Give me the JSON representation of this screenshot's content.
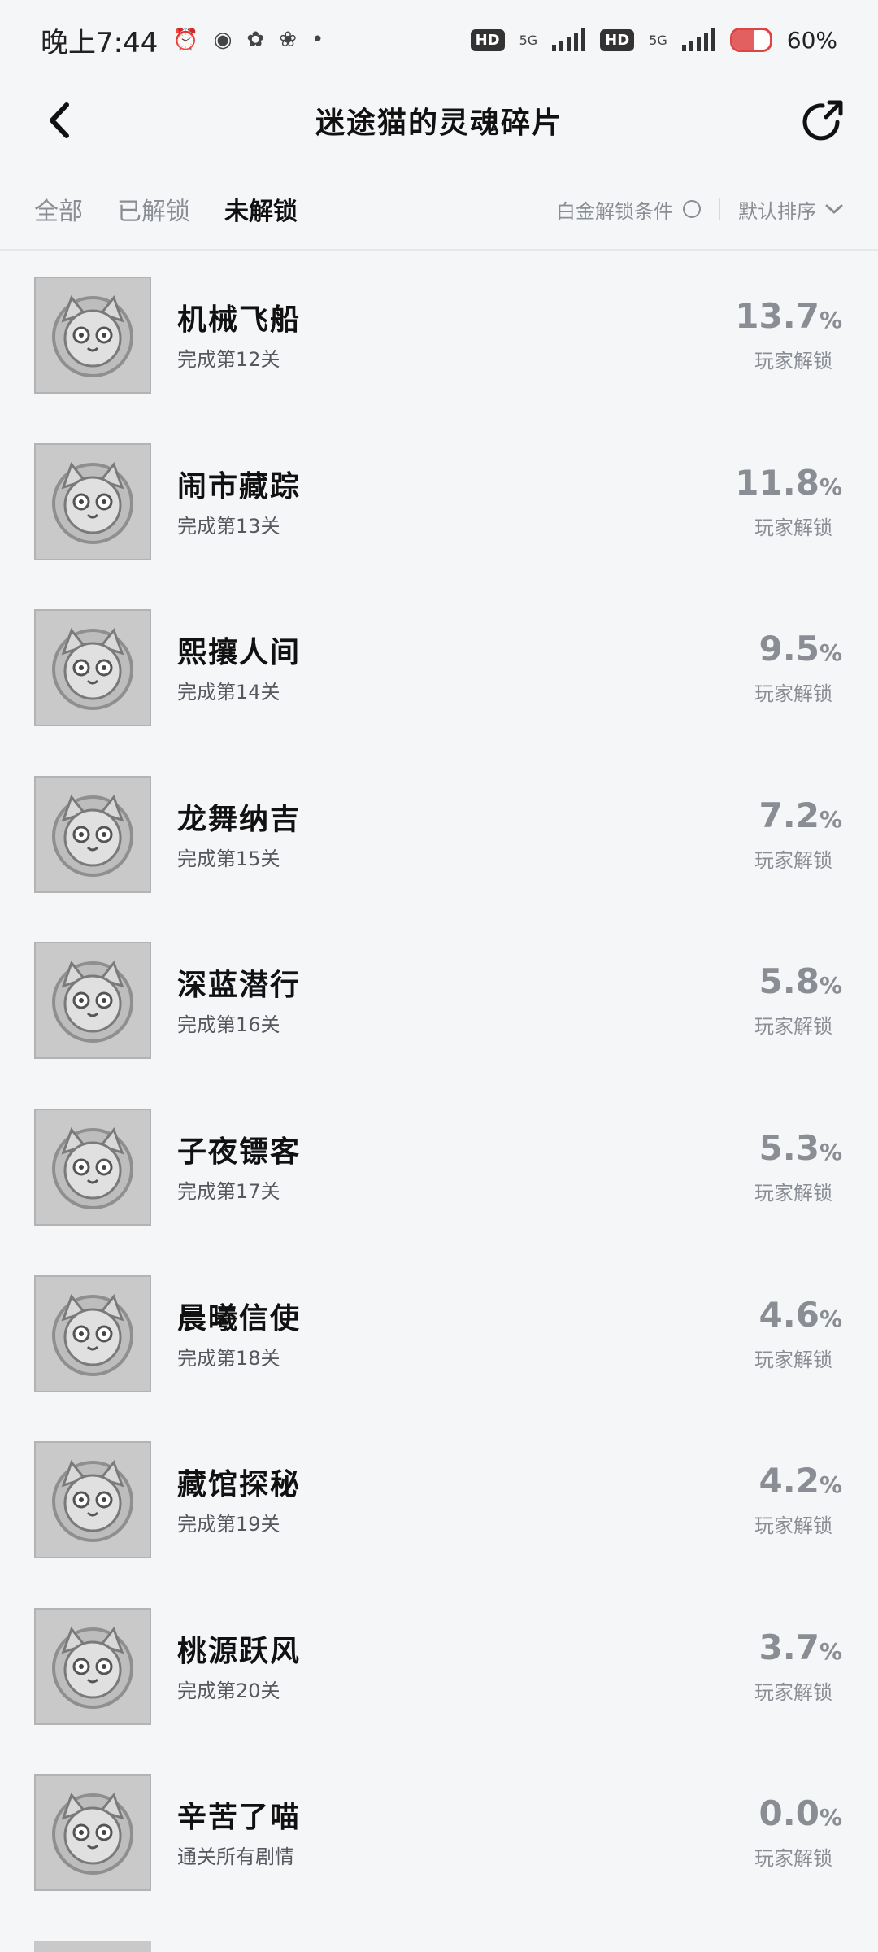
{
  "status": {
    "time": "晚上7:44",
    "hd1": "HD",
    "net1": "5G",
    "hd2": "HD",
    "net2": "5G",
    "battery_text": "60%",
    "battery_level": 0.6
  },
  "header": {
    "title": "迷途猫的灵魂碎片"
  },
  "tabs": [
    {
      "label": "全部"
    },
    {
      "label": "已解锁"
    },
    {
      "label": "未解锁"
    }
  ],
  "filter": {
    "label": "白金解锁条件"
  },
  "sort": {
    "label": "默认排序"
  },
  "items": [
    {
      "title": "机械飞船",
      "subtitle": "完成第12关",
      "percent": "13.7",
      "unit": "%",
      "caption": "玩家解锁"
    },
    {
      "title": "闹市藏踪",
      "subtitle": "完成第13关",
      "percent": "11.8",
      "unit": "%",
      "caption": "玩家解锁"
    },
    {
      "title": "熙攘人间",
      "subtitle": "完成第14关",
      "percent": "9.5",
      "unit": "%",
      "caption": "玩家解锁"
    },
    {
      "title": "龙舞纳吉",
      "subtitle": "完成第15关",
      "percent": "7.2",
      "unit": "%",
      "caption": "玩家解锁"
    },
    {
      "title": "深蓝潜行",
      "subtitle": "完成第16关",
      "percent": "5.8",
      "unit": "%",
      "caption": "玩家解锁"
    },
    {
      "title": "子夜镖客",
      "subtitle": "完成第17关",
      "percent": "5.3",
      "unit": "%",
      "caption": "玩家解锁"
    },
    {
      "title": "晨曦信使",
      "subtitle": "完成第18关",
      "percent": "4.6",
      "unit": "%",
      "caption": "玩家解锁"
    },
    {
      "title": "藏馆探秘",
      "subtitle": "完成第19关",
      "percent": "4.2",
      "unit": "%",
      "caption": "玩家解锁"
    },
    {
      "title": "桃源跃风",
      "subtitle": "完成第20关",
      "percent": "3.7",
      "unit": "%",
      "caption": "玩家解锁"
    },
    {
      "title": "辛苦了喵",
      "subtitle": "通关所有剧情",
      "percent": "0.0",
      "unit": "%",
      "caption": "玩家解锁"
    }
  ],
  "colors": {
    "background": "#f5f6f8",
    "muted": "#8a8d93",
    "thumb": "#c9c9c9"
  }
}
